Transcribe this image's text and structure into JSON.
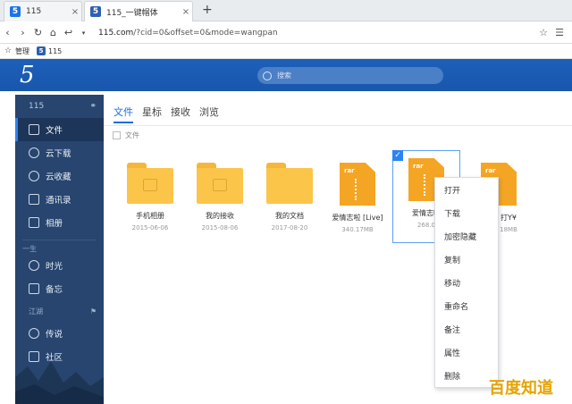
{
  "browser": {
    "tabs": [
      {
        "favicon": "5",
        "title": "115",
        "close": "×"
      },
      {
        "favicon": "5",
        "title": "115_一键帽体",
        "close": "×"
      }
    ],
    "new_tab": "+",
    "url_host": "115.com",
    "url_path": "/?cid=0&offset=0&mode=wangpan",
    "bookmarks": [
      {
        "icon": "star-icon",
        "glyph": "☆",
        "label": "管理"
      },
      {
        "icon": "115-icon",
        "glyph": "5",
        "label": "115"
      }
    ]
  },
  "app": {
    "logo": "5",
    "search_placeholder": "搜索"
  },
  "sidebar": {
    "account": "115",
    "items": [
      {
        "label": "文件",
        "icon": "file-icon",
        "active": true
      },
      {
        "label": "云下载",
        "icon": "cloud-download-icon"
      },
      {
        "label": "云收藏",
        "icon": "cloud-star-icon"
      },
      {
        "label": "通讯录",
        "icon": "contacts-icon"
      },
      {
        "label": "相册",
        "icon": "photo-icon"
      }
    ],
    "divider_label": "一生",
    "items2": [
      {
        "label": "时光",
        "icon": "clock-icon"
      },
      {
        "label": "备忘",
        "icon": "note-icon"
      }
    ],
    "section_label": "江湖",
    "items3": [
      {
        "label": "传说",
        "icon": "legend-icon"
      },
      {
        "label": "社区",
        "icon": "community-icon"
      }
    ]
  },
  "main": {
    "tabs": [
      "文件",
      "星标",
      "接收",
      "浏览"
    ],
    "select_all_label": "文件",
    "files": [
      {
        "name": "手机相册",
        "meta": "2015-06-06",
        "kind": "folder"
      },
      {
        "name": "我的接收",
        "meta": "2015-08-06",
        "kind": "folder"
      },
      {
        "name": "我的文档",
        "meta": "2017-08-20",
        "kind": "folder"
      },
      {
        "name": "爱情志啦 [Live]",
        "meta": "340.17MB",
        "kind": "rar",
        "ext": "rar"
      },
      {
        "name": "爱情志啦",
        "meta": "268.0",
        "kind": "rar",
        "ext": "rar",
        "selected": true
      },
      {
        "name": "打Y¥",
        "meta": "18MB",
        "kind": "rar",
        "ext": "rar"
      }
    ]
  },
  "context_menu": {
    "items": [
      "打开",
      "下载",
      "加密隐藏",
      "复制",
      "移动",
      "重命名",
      "备注",
      "属性",
      "删除"
    ]
  },
  "watermark": "百度知道"
}
